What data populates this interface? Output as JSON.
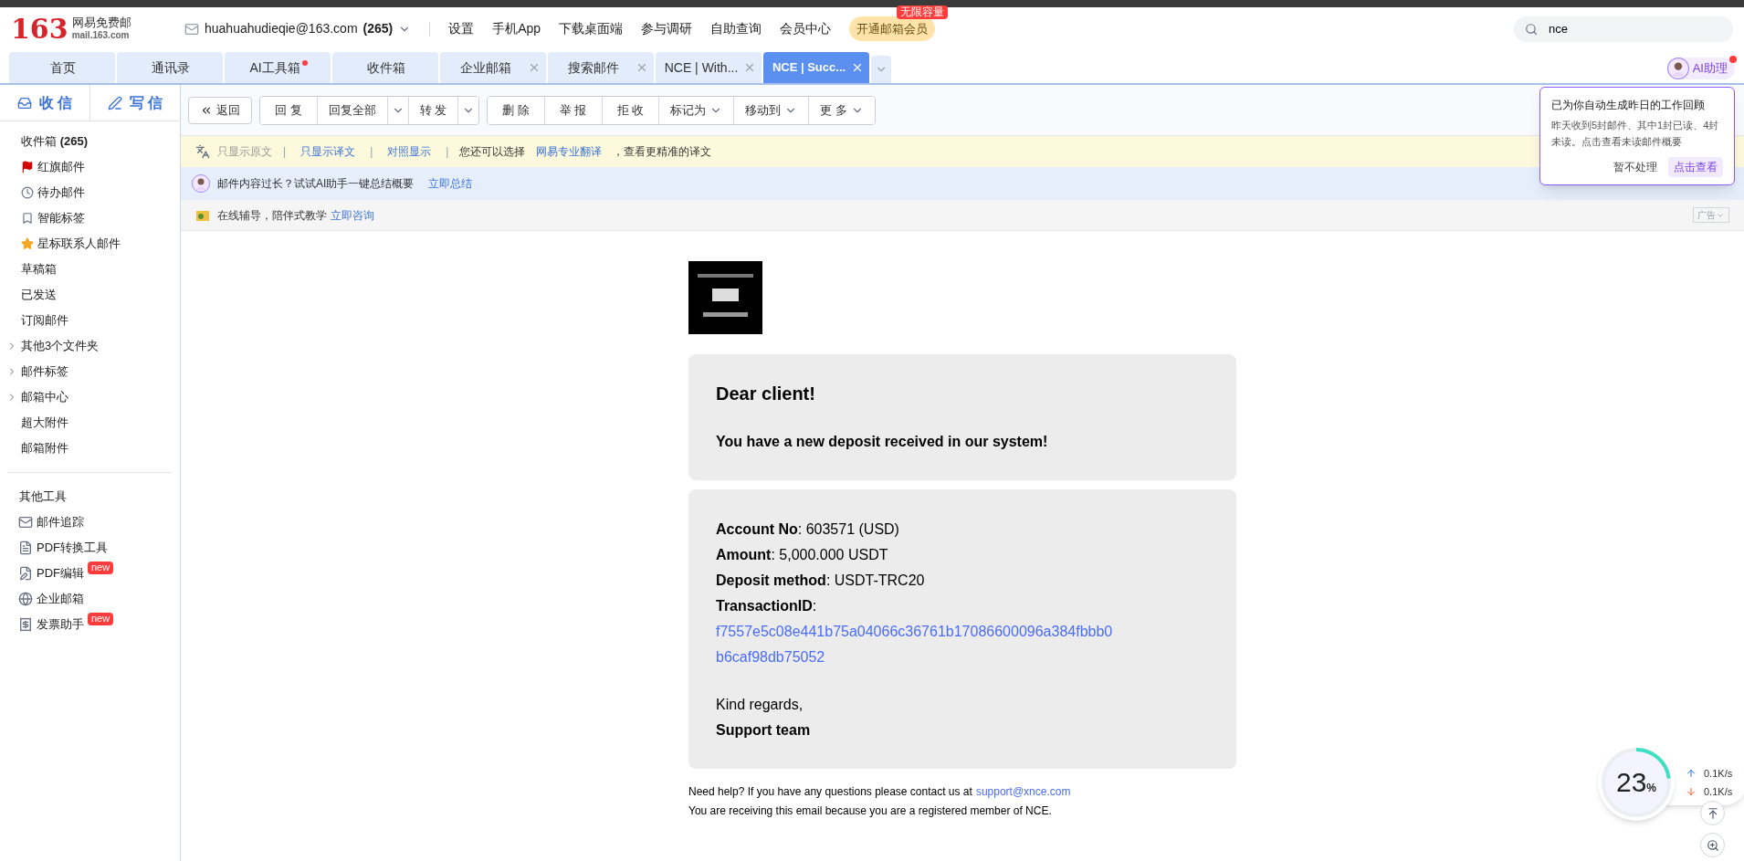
{
  "header": {
    "logo_number": "163",
    "logo_name": "网易免费邮",
    "logo_domain": "mail.163.com",
    "account": "huahuahudieqie@163.com",
    "account_count": "(265)",
    "nav": [
      "设置",
      "手机App",
      "下载桌面端",
      "参与调研",
      "自助查询",
      "会员中心"
    ],
    "vip_label": "开通邮箱会员",
    "vip_badge": "无限容量",
    "search_value": "nce"
  },
  "tabs": [
    {
      "label": "首页",
      "selected": false,
      "closable": false,
      "dot": false
    },
    {
      "label": "通讯录",
      "selected": false,
      "closable": false,
      "dot": false
    },
    {
      "label": "AI工具箱",
      "selected": false,
      "closable": false,
      "dot": true
    },
    {
      "label": "收件箱",
      "selected": false,
      "closable": false,
      "dot": false
    },
    {
      "label": "企业邮箱",
      "selected": false,
      "closable": true,
      "dot": false
    },
    {
      "label": "搜索邮件",
      "selected": false,
      "closable": true,
      "dot": false
    },
    {
      "label": "NCE | With...",
      "selected": false,
      "closable": true,
      "dot": false
    },
    {
      "label": "NCE | Succ...",
      "selected": true,
      "closable": true,
      "dot": false
    }
  ],
  "ai_assistant": {
    "label": "AI助理",
    "dot": true
  },
  "popover": {
    "title": "已为你自动生成昨日的工作回顾",
    "body": "昨天收到5封邮件、其中1封已读、4封未读。点击查看未读邮件概要",
    "dismiss": "暂不处理",
    "view": "点击查看"
  },
  "sidebar": {
    "receive": "收 信",
    "write": "写 信",
    "folders": [
      {
        "label": "收件箱",
        "count": "(265)",
        "kind": "plain"
      },
      {
        "label": "红旗邮件",
        "kind": "flag"
      },
      {
        "label": "待办邮件",
        "kind": "clock"
      },
      {
        "label": "智能标签",
        "kind": "bookmark"
      },
      {
        "label": "星标联系人邮件",
        "kind": "star"
      },
      {
        "label": "草稿箱",
        "kind": "plain"
      },
      {
        "label": "已发送",
        "kind": "plain"
      },
      {
        "label": "订阅邮件",
        "kind": "plain"
      },
      {
        "label": "其他3个文件夹",
        "kind": "group"
      },
      {
        "label": "邮件标签",
        "kind": "group"
      },
      {
        "label": "邮箱中心",
        "kind": "group"
      },
      {
        "label": "超大附件",
        "kind": "plain"
      },
      {
        "label": "邮箱附件",
        "kind": "plain"
      }
    ],
    "tools_title": "其他工具",
    "tools": [
      {
        "label": "邮件追踪",
        "kind": "mail"
      },
      {
        "label": "PDF转换工具",
        "kind": "pdf"
      },
      {
        "label": "PDF编辑",
        "kind": "pdf-edit",
        "badge": "new"
      },
      {
        "label": "企业邮箱",
        "kind": "globe"
      },
      {
        "label": "发票助手",
        "kind": "invoice",
        "badge": "new"
      }
    ]
  },
  "toolbar": [
    [
      {
        "label": "返回",
        "kind": "back"
      }
    ],
    [
      {
        "label": "回 复",
        "kind": "plain"
      },
      {
        "label": "回复全部",
        "kind": "split"
      },
      {
        "label": "转 发",
        "kind": "split"
      }
    ],
    [
      {
        "label": "删 除",
        "kind": "plain"
      },
      {
        "label": "举 报",
        "kind": "plain"
      },
      {
        "label": "拒 收",
        "kind": "plain"
      },
      {
        "label": "标记为",
        "kind": "menu"
      },
      {
        "label": "移动到",
        "kind": "menu"
      },
      {
        "label": "更 多",
        "kind": "menu"
      }
    ]
  ],
  "translate_bar": [
    {
      "kind": "muted",
      "text": "只显示原文"
    },
    {
      "kind": "separator",
      "text": "|"
    },
    {
      "kind": "link",
      "text": "只显示译文"
    },
    {
      "kind": "separator",
      "text": "|"
    },
    {
      "kind": "link",
      "text": "对照显示"
    },
    {
      "kind": "separator",
      "text": "|"
    },
    {
      "kind": "text",
      "text": "您还可以选择"
    },
    {
      "kind": "link",
      "text": "网易专业翻译"
    },
    {
      "kind": "text",
      "text": "，查看更精准的译文"
    }
  ],
  "ai_bar": {
    "text": "邮件内容过长？试试AI助手一键总结概要",
    "link": "立即总结"
  },
  "ad_bar": {
    "text": "在线辅导，陪伴式教学",
    "link": "立即咨询",
    "ad_label": "广告"
  },
  "email": {
    "greeting": "Dear client!",
    "headline": "You have a new deposit received in our system!",
    "fields": [
      {
        "label": "Account No",
        "value": ": 603571 (USD)"
      },
      {
        "label": "Amount",
        "value": ": 5,000.000 USDT"
      },
      {
        "label": "Deposit method",
        "value": ": USDT-TRC20"
      },
      {
        "label": "TransactionID",
        "value": ":"
      }
    ],
    "transaction_id": "f7557e5c08e441b75a04066c36761b17086600096a384fbbb0b6caf98db75052",
    "regards": "Kind regards,",
    "signature": "Support team",
    "help": "Need help? If you have any questions please contact us at",
    "help_email": "support@xnce.com",
    "footer": "You are receiving this email because you are a registered member of NCE."
  },
  "meter": {
    "level": 0.23,
    "number": "23",
    "unit": "%",
    "up": "0.1K/s",
    "down": "0.1K/s"
  }
}
